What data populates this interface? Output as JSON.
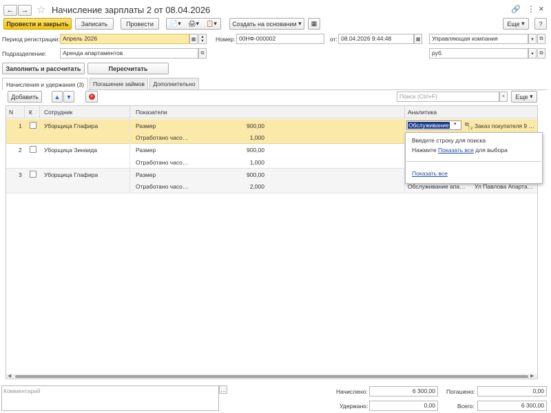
{
  "window": {
    "title": "Начисление зарплаты 2 от 08.04.2026"
  },
  "toolbar": {
    "post_close": "Провести и закрыть",
    "save": "Записать",
    "post": "Провести",
    "create_based": "Создать на основании",
    "more": "Еще",
    "help": "?"
  },
  "header": {
    "period_label": "Период регистрации:",
    "period_value": "Апрель 2026",
    "number_label": "Номер:",
    "number_value": "00НФ-000002",
    "date_label": "от:",
    "date_value": "08.04.2026  9:44:48",
    "org_value": "Управляющая компания",
    "division_label": "Подразделение:",
    "division_value": "Аренда апартаментов",
    "currency_value": "руб."
  },
  "actions": {
    "fill_calc": "Заполнить и рассчитать",
    "recalc": "Пересчитать"
  },
  "tabs": [
    {
      "label": "Начисления и удержания (3)"
    },
    {
      "label": "Погашение займов"
    },
    {
      "label": "Дополнительно"
    }
  ],
  "table_toolbar": {
    "add": "Добавить",
    "search_placeholder": "Поиск (Ctrl+F)",
    "more": "Еще"
  },
  "table": {
    "headers": {
      "n": "N",
      "k": "К",
      "employee": "Сотрудник",
      "indicators": "Показатели",
      "analytics": "Аналитика"
    },
    "rows": [
      {
        "n": "1",
        "employee": "Уборщица Глафира",
        "ind1": "Размер",
        "val1": "900,00",
        "ind2": "Отработано часо…",
        "val2": "1,000",
        "analytics_edit": "Обслуживание",
        "analytics2": "Заказ покупателя 9 …"
      },
      {
        "n": "2",
        "employee": "Уборщица Зинаида",
        "ind1": "Размер",
        "val1": "900,00",
        "ind2": "Отработано часо…",
        "val2": "1,000"
      },
      {
        "n": "3",
        "employee": "Уборщица Глафира",
        "ind1": "Размер",
        "val1": "900,00",
        "ind2": "Отработано часо…",
        "val2": "2,000",
        "analytics1": "Обслуживание апа…",
        "analytics2": "Ул Павлова Апарта…"
      }
    ]
  },
  "popup": {
    "line1": "Введите строку для поиска",
    "line2_pre": "Нажмите ",
    "line2_link": "Показать все",
    "line2_post": " для выбора",
    "show_all": "Показать все"
  },
  "footer": {
    "comment_placeholder": "Комментарий",
    "accrued_label": "Начислено:",
    "accrued_value": "6 300,00",
    "repaid_label": "Погашено:",
    "repaid_value": "0,00",
    "withheld_label": "Удержано:",
    "withheld_value": "0,00",
    "total_label": "Всего:",
    "total_value": "6 300,00"
  }
}
